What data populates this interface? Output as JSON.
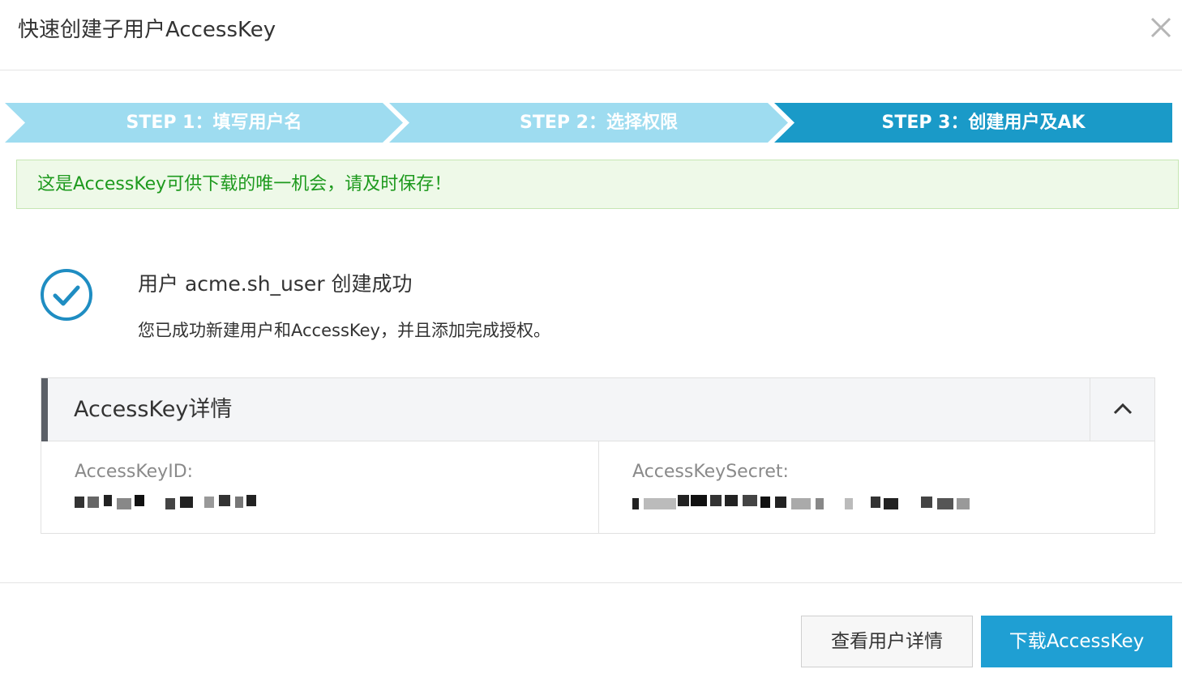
{
  "dialog": {
    "title": "快速创建子用户AccessKey"
  },
  "steps": [
    {
      "label": "STEP 1：填写用户名",
      "state": "done"
    },
    {
      "label": "STEP 2：选择权限",
      "state": "done"
    },
    {
      "label": "STEP 3：创建用户及AK",
      "state": "active"
    }
  ],
  "notice": {
    "text": "这是AccessKey可供下载的唯一机会，请及时保存！"
  },
  "success": {
    "title": "用户 acme.sh_user 创建成功",
    "subtitle": "您已成功新建用户和AccessKey，并且添加完成授权。"
  },
  "accesskey": {
    "section_title": "AccessKey详情",
    "id_label": "AccessKeyID:",
    "secret_label": "AccessKeySecret:"
  },
  "buttons": {
    "view_user": "查看用户详情",
    "download": "下载AccessKey"
  },
  "colors": {
    "step_done": "#9edcf0",
    "step_active": "#1a9ac8",
    "primary": "#1f9fd3",
    "success": "#1f8dc2",
    "notice_text": "#1e9a1e"
  },
  "icons": {
    "close": "close-icon",
    "success": "check-circle-icon",
    "collapse": "chevron-up-icon"
  }
}
